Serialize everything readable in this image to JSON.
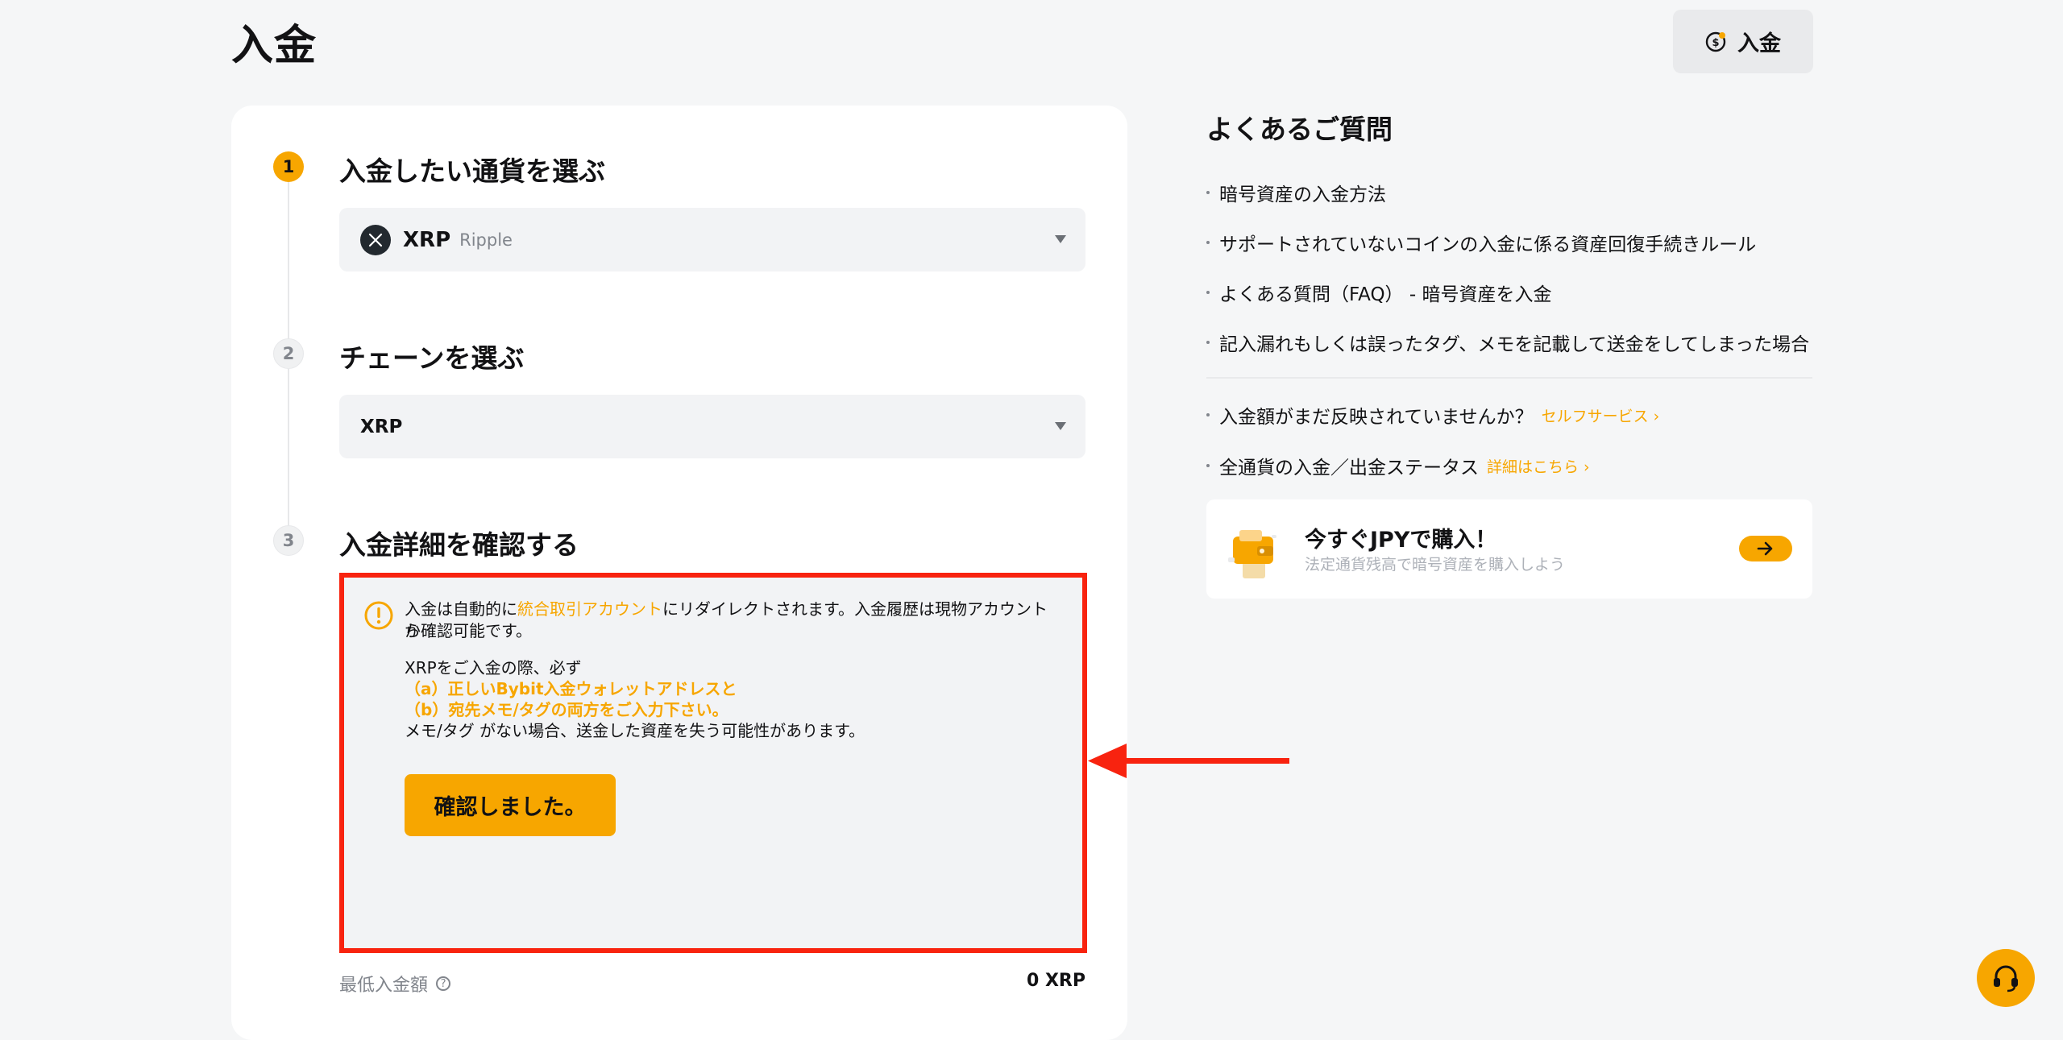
{
  "header": {
    "title": "入金",
    "deposit_button": "入金"
  },
  "steps": [
    {
      "num": "1",
      "title": "入金したい通貨を選ぶ"
    },
    {
      "num": "2",
      "title": "チェーンを選ぶ"
    },
    {
      "num": "3",
      "title": "入金詳細を確認する"
    }
  ],
  "coin_select": {
    "symbol": "XRP",
    "name": "Ripple",
    "icon": "xrp-icon"
  },
  "chain_select": {
    "value": "XRP"
  },
  "notice": {
    "line1_pre": "入金は自動的に",
    "line1_link": "統合取引アカウント",
    "line1_post": "にリダイレクトされます。入金履歴は現物アカウントか",
    "line2": "ら確認可能です。",
    "line3": "XRPをご入金の際、必ず",
    "line4": "（a）正しいBybit入金ウォレットアドレスと",
    "line5": "（b）宛先メモ/タグの両方をご入力下さい。",
    "line6": "メモ/タグ がない場合、送金した資産を失う可能性があります。",
    "confirm_button": "確認しました。"
  },
  "min_deposit": {
    "label": "最低入金額",
    "value": "0 XRP"
  },
  "faq": {
    "title": "よくあるご質問",
    "items": [
      "暗号資産の入金方法",
      "サポートされていないコインの入金に係る資産回復手続きルール",
      "よくある質問（FAQ） - 暗号資産を入金",
      "記入漏れもしくは誤ったタグ、メモを記載して送金をしてしまった場合"
    ],
    "extra": [
      {
        "text": "入金額がまだ反映されていませんか？",
        "link": "セルフサービス ›"
      },
      {
        "text": "全通貨の入金／出金ステータス",
        "link": "詳細はこちら ›"
      }
    ]
  },
  "promo": {
    "title": "今すぐJPYで購入！",
    "subtitle": "法定通貨残高で暗号資産を購入しよう"
  },
  "colors": {
    "accent": "#f7a600",
    "annotation_red": "#f8230f",
    "page_bg": "#f5f6f7"
  }
}
